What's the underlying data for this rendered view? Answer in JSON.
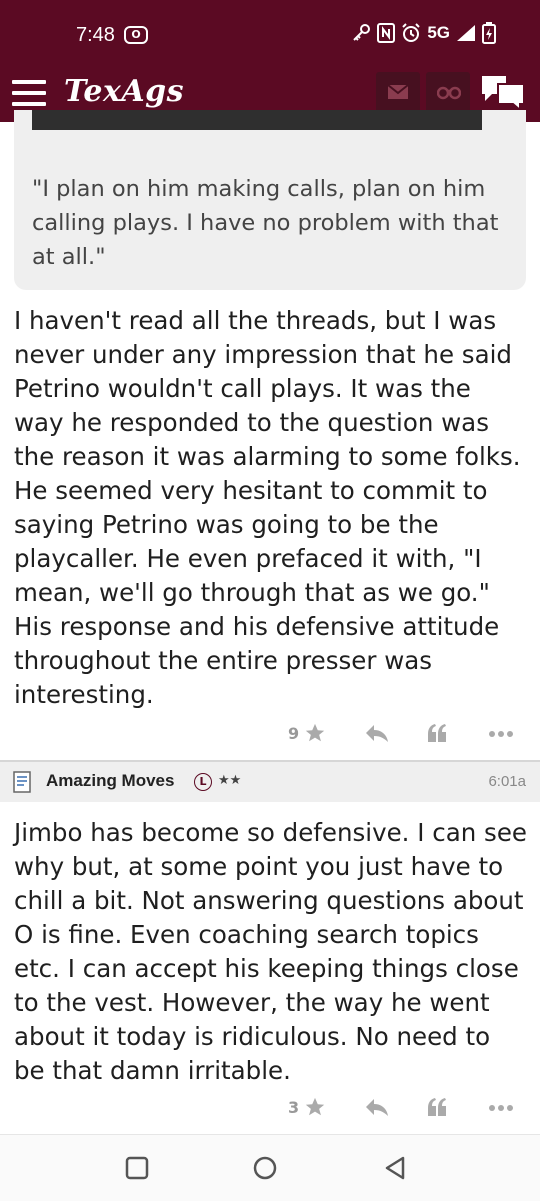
{
  "status_bar": {
    "time": "7:48",
    "network": "5G",
    "rec_label": "O"
  },
  "app": {
    "title": "TexAgs",
    "brand_color": "#5b0a23"
  },
  "quote": {
    "text": "\"I plan on him making calls, plan on him calling plays. I have no problem with that at all.\""
  },
  "posts": [
    {
      "text": "I haven't read all the threads, but I was never under any impression that he said Petrino wouldn't call plays. It was the way he responded to the question was the reason it was alarming to some folks. He seemed very hesitant to commit to saying Petrino was going to be the playcaller. He even prefaced it with, \"I mean, we'll go through that as we go.\" His response and his defensive attitude throughout the entire presser was interesting.",
      "likes": "9"
    },
    {
      "author": "Amazing Moves",
      "badge": "L",
      "stars": "★★",
      "time": "6:01a",
      "text": "Jimbo has become so defensive. I can see why but, at some point you just have to chill a bit. Not answering questions about O is fine. Even coaching search topics etc. I can accept his keeping things close to the vest. However, the way he went about it today is ridiculous. No need to be that damn irritable.",
      "likes": "3"
    }
  ],
  "icons": {
    "menu": "hamburger-icon",
    "mail": "mail-icon",
    "binoculars": "binoculars-icon",
    "chat": "chat-bubbles-icon",
    "star": "star-icon",
    "reply": "reply-icon",
    "quote": "quote-icon",
    "more": "more-icon"
  }
}
